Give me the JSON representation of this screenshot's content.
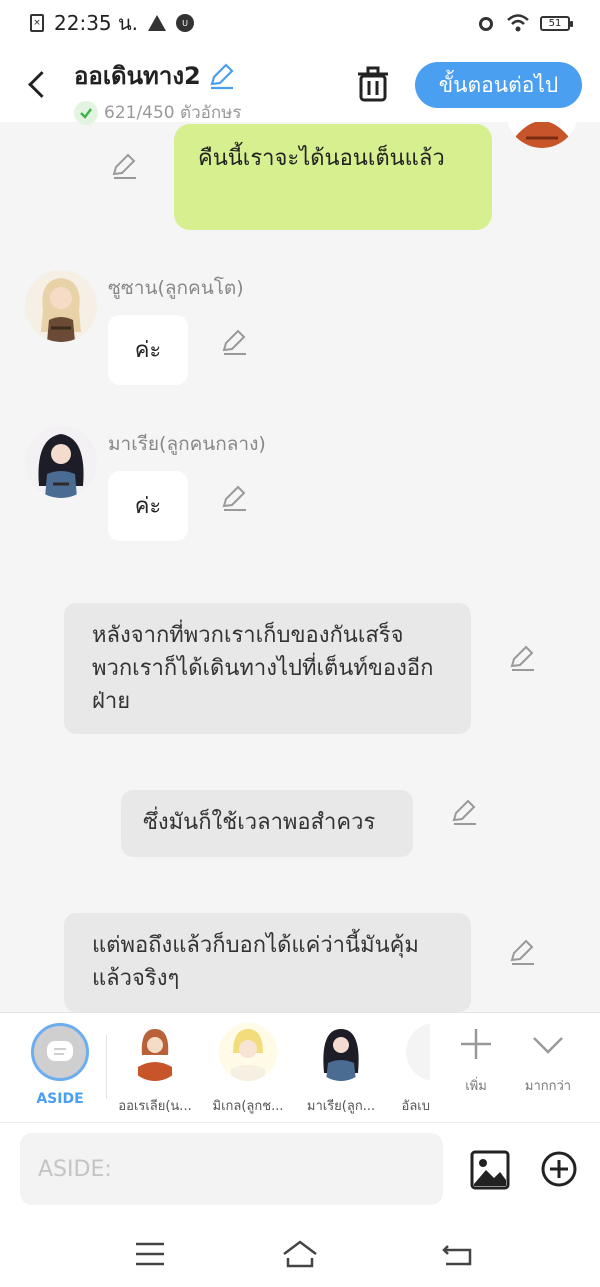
{
  "status_bar": {
    "time": "22:35 น.",
    "battery": "51"
  },
  "header": {
    "title": "ออเดินทาง2",
    "char_count": "621/450 ตัวอักษร",
    "next_button": "ขั้นตอนต่อไป"
  },
  "messages": {
    "m1": {
      "text": "คืนนี้เราจะได้นอนเต็นแล้ว"
    },
    "m2": {
      "speaker": "ซูซาน(ลูกคนโต)",
      "text": "ค่ะ"
    },
    "m3": {
      "speaker": "มาเรีย(ลูกคนกลาง)",
      "text": "ค่ะ"
    },
    "m4": {
      "text": "หลังจากที่พวกเราเก็บของกันเสร็จพวกเราก็ได้เดินทางไปที่เต็นท์ของอีกฝ่าย"
    },
    "m5": {
      "text": "ซึ่งมันก็ใช้เวลาพอสำควร"
    },
    "m6": {
      "text": "แต่พอถึงแล้วก็บอกได้แค่ว่านี้มันคุ้มแล้วจริงๆ"
    }
  },
  "characters": {
    "aside": "ASIDE",
    "c1": "ออเรเลีย(น...",
    "c2": "มิเกล(ลูกช...",
    "c3": "มาเรีย(ลูก...",
    "c4": "อัลเบ",
    "add": "เพิ่ม",
    "more": "มากกว่า"
  },
  "input": {
    "placeholder": "ASIDE:"
  },
  "colors": {
    "accent": "#4a9ff0",
    "my_bubble": "#d6ef8f",
    "narration": "#e8e8e8"
  }
}
